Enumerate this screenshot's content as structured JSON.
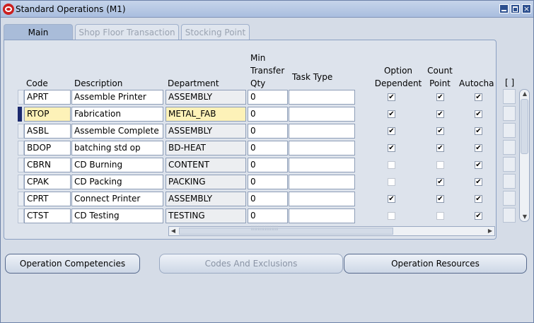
{
  "window": {
    "title": "Standard Operations (M1)",
    "close_glyph": "×"
  },
  "tabs": [
    {
      "label": "Main",
      "active": true
    },
    {
      "label": "Shop Floor Transaction",
      "active": false
    },
    {
      "label": "Stocking Point",
      "active": false
    }
  ],
  "columns": {
    "code": "Code",
    "description": "Description",
    "department": "Department",
    "min_transfer_qty_1": "Min",
    "min_transfer_qty_2": "Transfer",
    "min_transfer_qty_3": "Qty",
    "task_type": "Task Type",
    "option_dependent_1": "Option",
    "option_dependent_2": "Dependent",
    "count_point_1": "Count",
    "count_point_2": "Point",
    "autocharge": "Autocha",
    "flex_field": "[ ]"
  },
  "rows": [
    {
      "code": "APRT",
      "description": "Assemble Printer",
      "department": "ASSEMBLY",
      "min_qty": "0",
      "task_type": "",
      "option_dependent": true,
      "count_point": true,
      "autocharge": true,
      "current": false
    },
    {
      "code": "RTOP",
      "description": "Fabrication",
      "department": "METAL_FAB",
      "min_qty": "0",
      "task_type": "",
      "option_dependent": true,
      "count_point": true,
      "autocharge": true,
      "current": true
    },
    {
      "code": "ASBL",
      "description": "Assemble Complete",
      "department": "ASSEMBLY",
      "min_qty": "0",
      "task_type": "",
      "option_dependent": true,
      "count_point": true,
      "autocharge": true,
      "current": false
    },
    {
      "code": "BDOP",
      "description": "batching std op",
      "department": "BD-HEAT",
      "min_qty": "0",
      "task_type": "",
      "option_dependent": true,
      "count_point": true,
      "autocharge": true,
      "current": false
    },
    {
      "code": "CBRN",
      "description": "CD Burning",
      "department": "CONTENT",
      "min_qty": "0",
      "task_type": "",
      "option_dependent": false,
      "count_point": false,
      "autocharge": true,
      "current": false
    },
    {
      "code": "CPAK",
      "description": "CD Packing",
      "department": "PACKING",
      "min_qty": "0",
      "task_type": "",
      "option_dependent": false,
      "count_point": true,
      "autocharge": true,
      "current": false
    },
    {
      "code": "CPRT",
      "description": "Connect Printer",
      "department": "ASSEMBLY",
      "min_qty": "0",
      "task_type": "",
      "option_dependent": true,
      "count_point": true,
      "autocharge": true,
      "current": false
    },
    {
      "code": "CTST",
      "description": "CD Testing",
      "department": "TESTING",
      "min_qty": "0",
      "task_type": "",
      "option_dependent": false,
      "count_point": false,
      "autocharge": true,
      "current": false
    }
  ],
  "buttons": {
    "operation_competencies": "Operation Competencies",
    "codes_and_exclusions": "Codes And Exclusions",
    "operation_resources": "Operation Resources"
  },
  "glyphs": {
    "check": "✔",
    "left": "◀",
    "right": "▶",
    "up": "▲",
    "down": "▼"
  }
}
